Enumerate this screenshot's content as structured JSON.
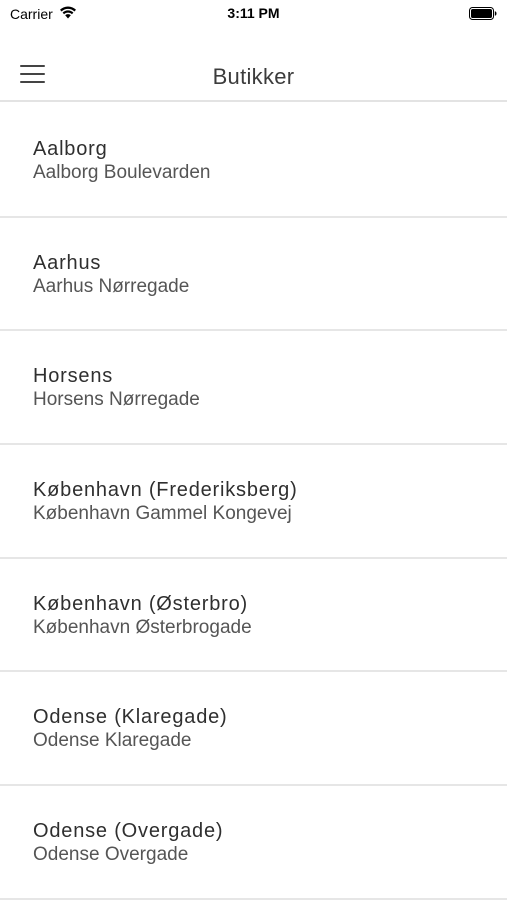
{
  "status_bar": {
    "carrier": "Carrier",
    "time": "3:11 PM",
    "wifi_icon": "wifi-icon",
    "battery_icon": "battery-full-icon"
  },
  "nav": {
    "title": "Butikker",
    "menu_icon": "hamburger-menu-icon"
  },
  "stores": [
    {
      "name": "Aalborg",
      "address": "Aalborg Boulevarden"
    },
    {
      "name": "Aarhus",
      "address": "Aarhus Nørregade"
    },
    {
      "name": "Horsens",
      "address": "Horsens Nørregade"
    },
    {
      "name": "København (Frederiksberg)",
      "address": "København Gammel Kongevej"
    },
    {
      "name": "København (Østerbro)",
      "address": "København Østerbrogade"
    },
    {
      "name": "Odense (Klaregade)",
      "address": "Odense Klaregade"
    },
    {
      "name": "Odense (Overgade)",
      "address": "Odense Overgade"
    }
  ],
  "colors": {
    "background": "#ffffff",
    "divider": "#e6e6e6",
    "text_primary": "#2f2f2f",
    "text_secondary": "#555555"
  }
}
